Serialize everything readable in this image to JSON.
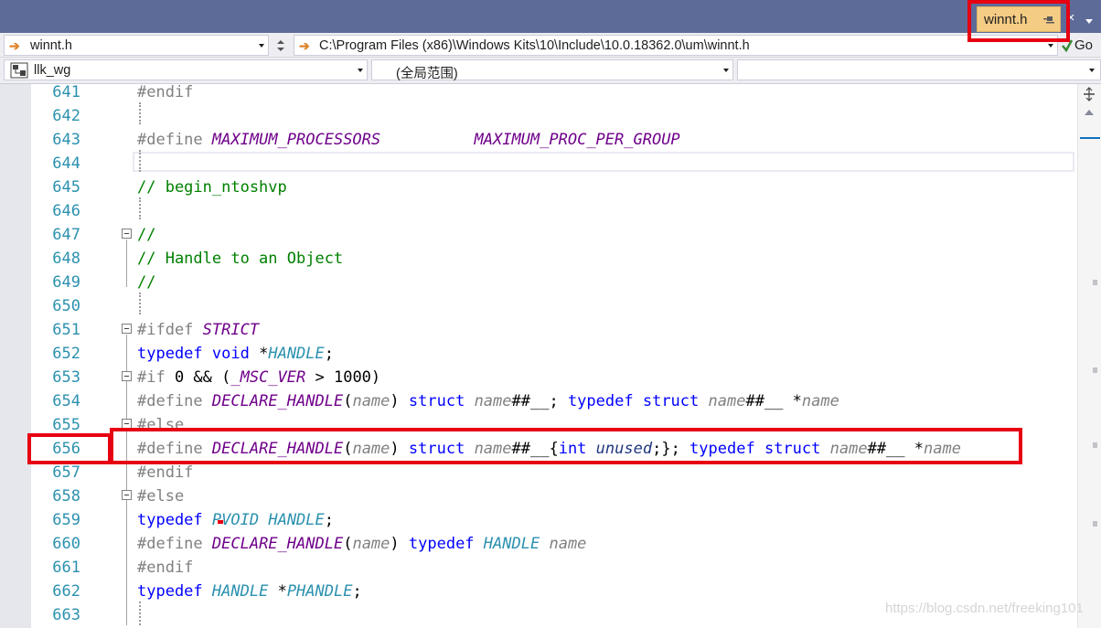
{
  "tab": {
    "file_name": "winnt.h",
    "close_glyph": "×"
  },
  "navbar": {
    "file_selector": "winnt.h",
    "file_path": "C:\\Program Files (x86)\\Windows Kits\\10\\Include\\10.0.18362.0\\um\\winnt.h",
    "go_label": "Go",
    "project_selector": "llk_wg",
    "scope_selector": "(全局范围)",
    "member_selector": ""
  },
  "editor": {
    "line_numbers": [
      "641",
      "642",
      "643",
      "644",
      "645",
      "646",
      "647",
      "648",
      "649",
      "650",
      "651",
      "652",
      "653",
      "654",
      "655",
      "656",
      "657",
      "658",
      "659",
      "660",
      "661",
      "662",
      "663"
    ],
    "highlighted_line": "656"
  },
  "watermark": "https://blog.csdn.net/freeking101",
  "colors": {
    "annotation_red": "#e60012",
    "tab_active": "#f5cc84",
    "tabstrip": "#5d6b99",
    "keyword": "#0000ff",
    "macro": "#6f008a",
    "comment": "#008000",
    "line_number": "#2b91af"
  },
  "icons": {
    "pin": "pin-icon",
    "close": "close-icon",
    "overflow": "chevron-down-icon",
    "nav_arrow": "arrow-right-icon",
    "project": "project-icon",
    "go": "go-icon",
    "split": "split-icon"
  }
}
